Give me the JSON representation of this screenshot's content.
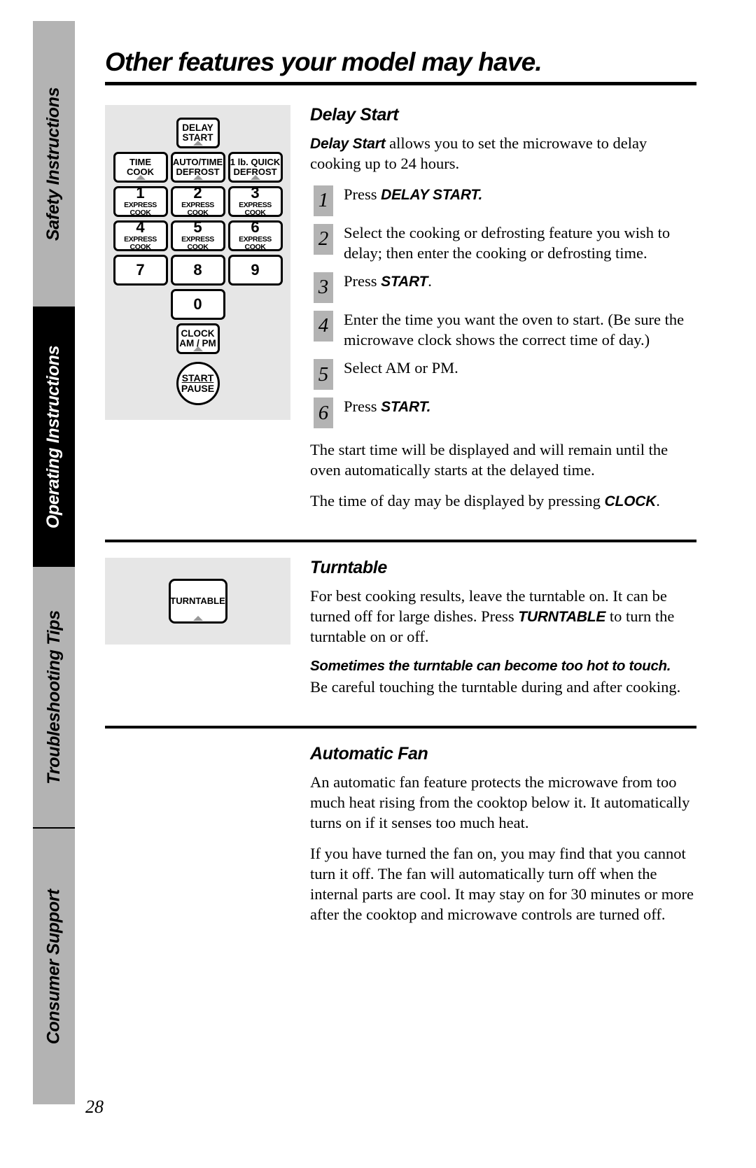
{
  "page": {
    "title": "Other features your model may have.",
    "number": "28"
  },
  "sidebar": {
    "tabs": [
      {
        "label": "Safety Instructions",
        "active": false
      },
      {
        "label": "Operating Instructions",
        "active": true
      },
      {
        "label": "Troubleshooting Tips",
        "active": false
      },
      {
        "label": "Consumer Support",
        "active": false
      }
    ]
  },
  "keypad": {
    "delay_start": {
      "line1": "DELAY",
      "line2": "START"
    },
    "function_row": [
      {
        "line1": "TIME",
        "line2": "COOK"
      },
      {
        "line1": "AUTO/TIME",
        "line2": "DEFROST"
      },
      {
        "line1": "1 lb. QUICK",
        "line2": "DEFROST"
      }
    ],
    "numbers": [
      {
        "digit": "1",
        "sub": "EXPRESS COOK"
      },
      {
        "digit": "2",
        "sub": "EXPRESS COOK"
      },
      {
        "digit": "3",
        "sub": "EXPRESS COOK"
      },
      {
        "digit": "4",
        "sub": "EXPRESS COOK"
      },
      {
        "digit": "5",
        "sub": "EXPRESS COOK"
      },
      {
        "digit": "6",
        "sub": "EXPRESS COOK"
      },
      {
        "digit": "7",
        "sub": ""
      },
      {
        "digit": "8",
        "sub": ""
      },
      {
        "digit": "9",
        "sub": ""
      },
      {
        "digit": "0",
        "sub": ""
      }
    ],
    "clock": {
      "line1": "CLOCK",
      "line2": "AM / PM"
    },
    "start_pause": {
      "line1": "START",
      "line2": "PAUSE"
    },
    "turntable": {
      "label": "TURNTABLE"
    }
  },
  "delay_start": {
    "heading": "Delay Start",
    "intro_bold": "Delay Start",
    "intro_rest": " allows you to set the microwave to delay cooking up to 24 hours.",
    "steps": [
      {
        "num": "1",
        "text_before": "Press ",
        "text_bold": "DELAY START.",
        "text_after": ""
      },
      {
        "num": "2",
        "text_before": "Select the cooking or defrosting feature you wish to delay; then enter the cooking or defrosting time.",
        "text_bold": "",
        "text_after": ""
      },
      {
        "num": "3",
        "text_before": "Press ",
        "text_bold": "START",
        "text_after": "."
      },
      {
        "num": "4",
        "text_before": "Enter the time you want the oven to start. (Be sure the microwave clock shows the correct time of day.)",
        "text_bold": "",
        "text_after": ""
      },
      {
        "num": "5",
        "text_before": "Select AM or PM.",
        "text_bold": "",
        "text_after": ""
      },
      {
        "num": "6",
        "text_before": "Press ",
        "text_bold": "START.",
        "text_after": ""
      }
    ],
    "para_1": "The start time will be displayed and will remain until the oven automatically starts at the delayed time.",
    "para_2_before": "The time of day may be displayed by pressing ",
    "para_2_bold": "CLOCK",
    "para_2_after": "."
  },
  "turntable": {
    "heading": "Turntable",
    "para_1_before": "For best cooking results, leave the turntable on. It can be turned off for large dishes. Press ",
    "para_1_bold": "TURNTABLE",
    "para_1_after": " to turn the turntable on or off.",
    "caution": "Sometimes the turntable can become too hot to touch.",
    "para_2": "Be careful touching the turntable during and after cooking."
  },
  "automatic_fan": {
    "heading": "Automatic Fan",
    "para_1": "An automatic fan feature protects the microwave from too much heat rising from the cooktop below it. It automatically turns on if it senses too much heat.",
    "para_2": "If you have turned the fan on, you may find that you cannot turn it off. The fan will automatically turn off when the internal parts are cool. It may stay on for 30 minutes or more after the cooktop and microwave controls are turned off."
  }
}
